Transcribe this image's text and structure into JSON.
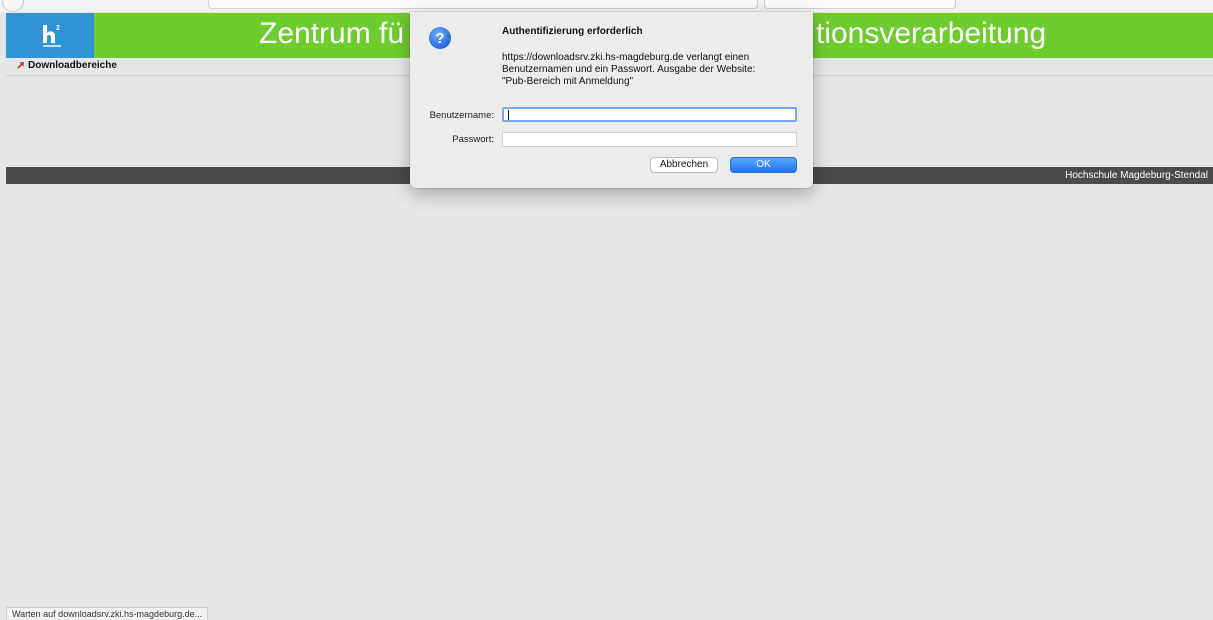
{
  "header": {
    "title_left": "Zentrum fü",
    "title_right": "tionsverarbeitung",
    "colors": {
      "bar": "#6fcc2f",
      "logo": "#2f93d6"
    }
  },
  "logo": {
    "icon": "hochschule-h2-logo"
  },
  "nav": {
    "link_label": "Downloadbereiche",
    "icon": "arrow-up-right-icon"
  },
  "footer": {
    "text": "Hochschule Magdeburg-Stendal"
  },
  "status": {
    "text": "Warten auf downloadsrv.zki.hs-magdeburg.de..."
  },
  "dialog": {
    "icon": "question-mark-icon",
    "title": "Authentifizierung erforderlich",
    "message_lines": [
      "https://downloadsrv.zki.hs-magdeburg.de verlangt einen",
      "Benutzernamen und ein Passwort. Ausgabe der Website:",
      "\"Pub-Bereich mit Anmeldung\""
    ],
    "username_label": "Benutzername:",
    "username_value": "",
    "password_label": "Passwort:",
    "password_value": "",
    "cancel_label": "Abbrechen",
    "ok_label": "OK",
    "colors": {
      "ok_button": "#1e74f1",
      "focus_ring": "#7aa7e6"
    }
  }
}
